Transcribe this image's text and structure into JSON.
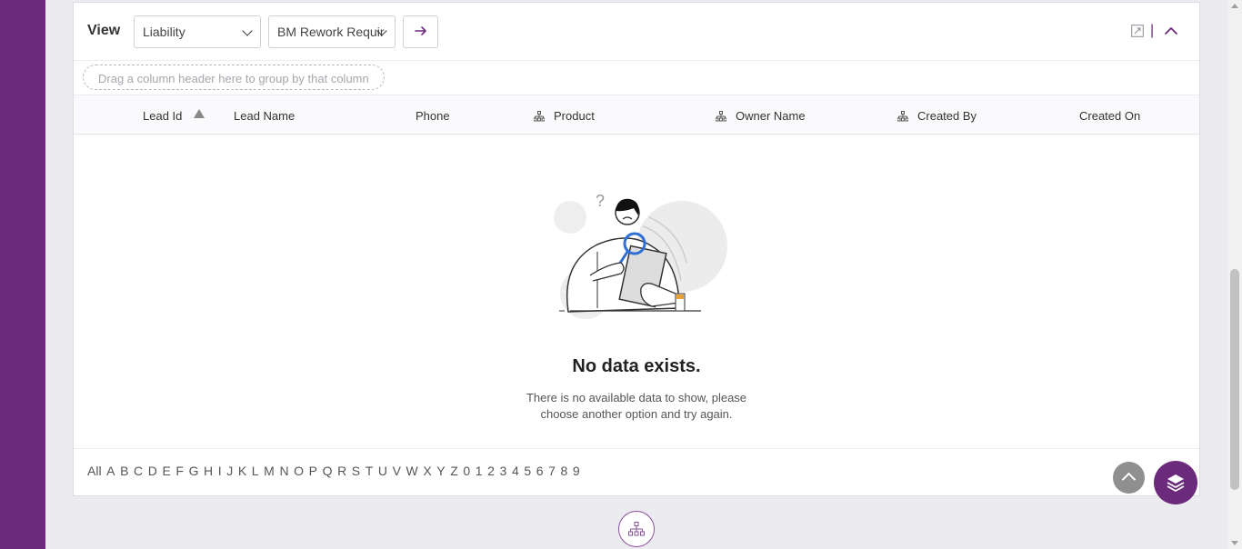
{
  "toolbar": {
    "view_label": "View",
    "view_select_1": "Liability",
    "view_select_2": "BM Rework Requir",
    "go_icon": "arrow-right-icon",
    "divider": "|"
  },
  "group_bar": {
    "placeholder": "Drag a column header here to group by that column"
  },
  "grid": {
    "columns": [
      "Lead Id",
      "Lead Name",
      "Phone",
      "Product",
      "Owner Name",
      "Created By",
      "Created On"
    ],
    "sorted_column": "Lead Id",
    "sort_direction": "ascending"
  },
  "empty_state": {
    "title": "No data exists.",
    "message": "There is no available data to show, please choose another option and try again."
  },
  "alphabet": [
    "All",
    "A",
    "B",
    "C",
    "D",
    "E",
    "F",
    "G",
    "H",
    "I",
    "J",
    "K",
    "L",
    "M",
    "N",
    "O",
    "P",
    "Q",
    "R",
    "S",
    "T",
    "U",
    "V",
    "W",
    "X",
    "Y",
    "Z",
    "0",
    "1",
    "2",
    "3",
    "4",
    "5",
    "6",
    "7",
    "8",
    "9"
  ],
  "colors": {
    "brand": "#6c2a7c",
    "background": "#ebebf0"
  }
}
